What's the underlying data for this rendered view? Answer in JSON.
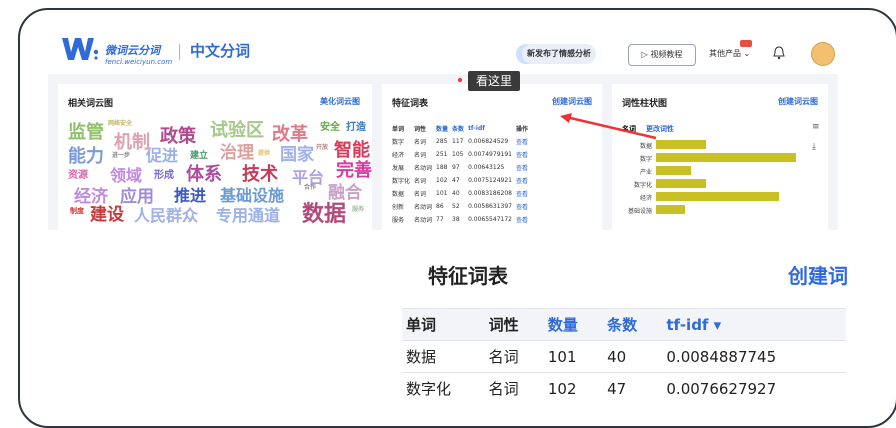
{
  "header": {
    "logo_text": "微词云分词",
    "logo_url": "fenci.weiciyun.com",
    "product": "中文分词",
    "new_feature": "新发布了情感分析",
    "video_btn": "视频教程",
    "other_btn": "其他产品"
  },
  "cards": {
    "wordcloud": {
      "title": "相关词云图",
      "link": "美化词云图"
    },
    "features": {
      "title": "特征词表",
      "link": "创建词云图",
      "tooltip": "看这里"
    },
    "bars": {
      "title": "词性柱状图",
      "link": "创建词云图",
      "filter_label": "名词",
      "filter_link": "更改词性"
    }
  },
  "wordcloud_words": [
    {
      "t": "监管",
      "c": "#8fbf6a"
    },
    {
      "t": "网络安全",
      "c": "#c8b26a"
    },
    {
      "t": "机制",
      "c": "#e0a0b0"
    },
    {
      "t": "政策",
      "c": "#b04a8e"
    },
    {
      "t": "试验区",
      "c": "#a4c88a"
    },
    {
      "t": "改革",
      "c": "#e07b8a"
    },
    {
      "t": "安全",
      "c": "#63a84a"
    },
    {
      "t": "打造",
      "c": "#3a7ac8"
    },
    {
      "t": "能力",
      "c": "#7a9ad8"
    },
    {
      "t": "进一步",
      "c": "#888"
    },
    {
      "t": "促进",
      "c": "#9ab0e8"
    },
    {
      "t": "建立",
      "c": "#4a9a6a"
    },
    {
      "t": "治理",
      "c": "#e0a0a0"
    },
    {
      "t": "提供",
      "c": "#e0c060"
    },
    {
      "t": "国家",
      "c": "#a0b0e8"
    },
    {
      "t": "开放",
      "c": "#a88"
    },
    {
      "t": "智能",
      "c": "#d83a5a"
    },
    {
      "t": "资源",
      "c": "#d86aa8"
    },
    {
      "t": "领域",
      "c": "#c08ae0"
    },
    {
      "t": "形成",
      "c": "#7a6ad8"
    },
    {
      "t": "体系",
      "c": "#b04aa0"
    },
    {
      "t": "技术",
      "c": "#c83a5a"
    },
    {
      "t": "平台",
      "c": "#b0a0e8"
    },
    {
      "t": "完善",
      "c": "#d83aa0"
    },
    {
      "t": "经济",
      "c": "#c08ae0"
    },
    {
      "t": "应用",
      "c": "#a08ad8"
    },
    {
      "t": "推进",
      "c": "#3a5ac8"
    },
    {
      "t": "基础设施",
      "c": "#6a9ad8"
    },
    {
      "t": "融合",
      "c": "#c8a0c8"
    },
    {
      "t": "合作",
      "c": "#888"
    },
    {
      "t": "制度",
      "c": "#c83a3a"
    },
    {
      "t": "建设",
      "c": "#c83a3a"
    },
    {
      "t": "人民群众",
      "c": "#a0b0e8"
    },
    {
      "t": "专用通道",
      "c": "#9ab0e8"
    },
    {
      "t": "数据",
      "c": "#b04a7a"
    },
    {
      "t": "服务",
      "c": "#a0c0a0"
    }
  ],
  "feature_table": {
    "headers": [
      "单词",
      "词性",
      "数量",
      "条数",
      "tf-idf",
      "操作"
    ],
    "rows": [
      [
        "数字",
        "名词",
        "285",
        "117",
        "0.006824529",
        "查看"
      ],
      [
        "经济",
        "名词",
        "251",
        "105",
        "0.0074979191",
        "查看"
      ],
      [
        "发展",
        "名动词",
        "188",
        "97",
        "0.00643125",
        "查看"
      ],
      [
        "数字化",
        "名词",
        "102",
        "47",
        "0.0075124921",
        "查看"
      ],
      [
        "数据",
        "名词",
        "101",
        "40",
        "0.0083186208",
        "查看"
      ],
      [
        "创新",
        "名动词",
        "86",
        "52",
        "0.0058631397",
        "查看"
      ],
      [
        "服务",
        "名动词",
        "77",
        "38",
        "0.0065547172",
        "查看"
      ]
    ]
  },
  "bar_chart": {
    "items": [
      {
        "label": "数据",
        "value": 101
      },
      {
        "label": "数字",
        "value": 285
      },
      {
        "label": "产业",
        "value": 72
      },
      {
        "label": "数字化",
        "value": 102
      },
      {
        "label": "经济",
        "value": 251
      },
      {
        "label": "基础设施",
        "value": 60
      }
    ]
  },
  "zoom": {
    "title": "特征词表",
    "link": "创建词",
    "headers": [
      "单词",
      "词性",
      "数量",
      "条数",
      "tf-idf ▾"
    ],
    "rows": [
      [
        "数据",
        "名词",
        "101",
        "40",
        "0.0084887745"
      ],
      [
        "数字化",
        "名词",
        "102",
        "47",
        "0.0076627927"
      ]
    ]
  }
}
